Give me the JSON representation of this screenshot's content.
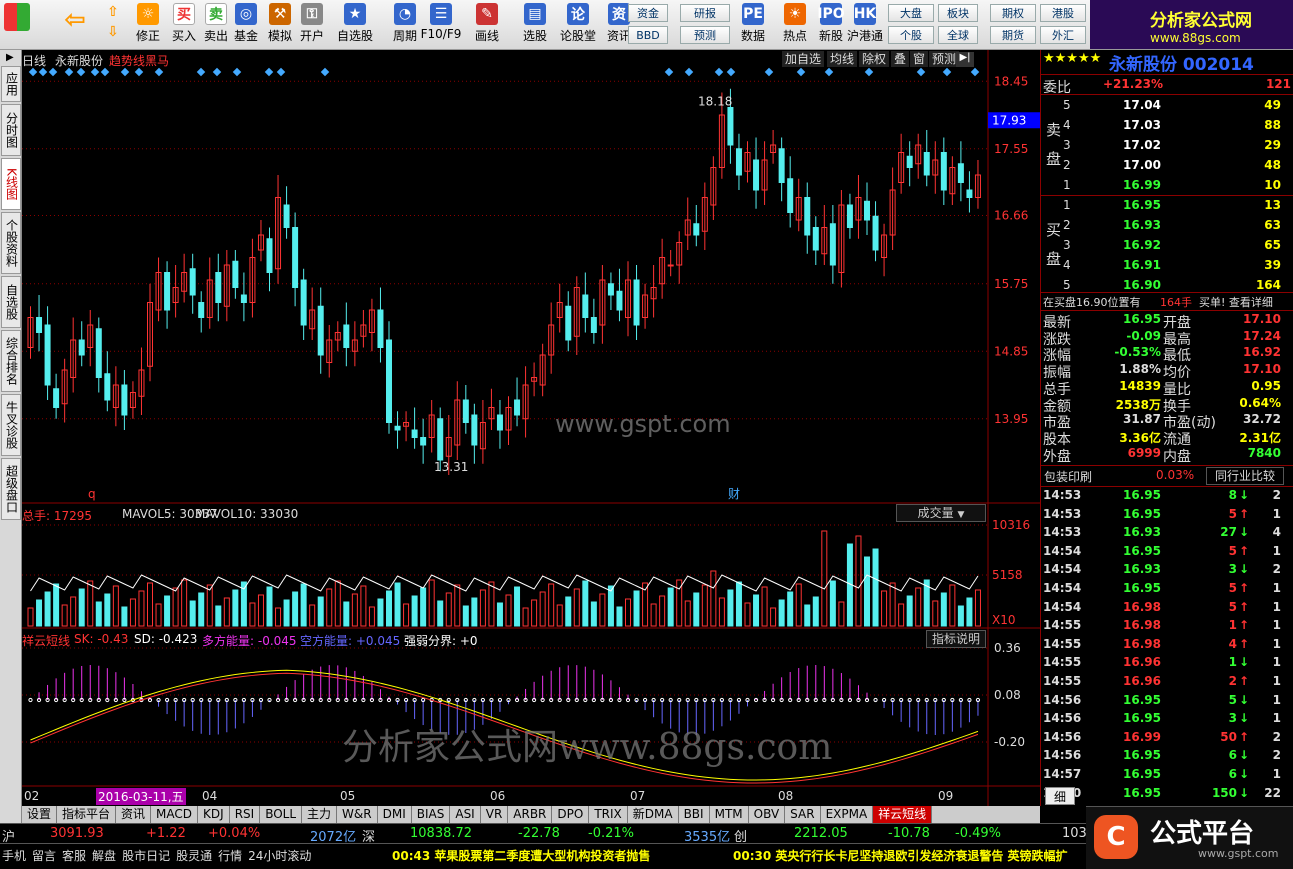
{
  "toolbar": {
    "buttons": [
      {
        "label": "修正",
        "icon": "gear-icon"
      },
      {
        "label": "买入",
        "icon": "buy-icon"
      },
      {
        "label": "卖出",
        "icon": "sell-icon"
      },
      {
        "label": "基金",
        "icon": "fund-icon"
      },
      {
        "label": "模拟",
        "icon": "hammer-icon"
      },
      {
        "label": "开户",
        "icon": "lock-icon"
      },
      {
        "label": "自选股",
        "icon": "star-icon"
      },
      {
        "label": "周期",
        "icon": "clock-icon"
      },
      {
        "label": "F10/F9",
        "icon": "doc-icon"
      },
      {
        "label": "画线",
        "icon": "pencil-icon"
      },
      {
        "label": "选股",
        "icon": "filter-icon"
      },
      {
        "label": "论股堂",
        "icon": "chat-icon"
      },
      {
        "label": "资讯",
        "icon": "news-icon"
      },
      {
        "label": "数据",
        "icon": "pe-icon"
      },
      {
        "label": "热点",
        "icon": "fire-icon"
      },
      {
        "label": "新股",
        "icon": "ipo-icon"
      },
      {
        "label": "沪港通",
        "icon": "hk-icon"
      }
    ],
    "small_buttons": [
      "资金",
      "BBD",
      "研报",
      "预测",
      "大盘",
      "个股",
      "板块",
      "全球",
      "期权",
      "期货",
      "港股",
      "外汇"
    ],
    "logo_title": "分析家公式网",
    "logo_url": "www.88gs.com"
  },
  "sidebar": [
    "应用",
    "分时图",
    "K线图",
    "个股资料",
    "自选股",
    "综合排名",
    "牛叉诊股",
    "超级盘口"
  ],
  "chart": {
    "period": "日线",
    "stock_name": "永新股份",
    "indicator": "趋势线黑马",
    "top_buttons": [
      "加自选",
      "均线",
      "除权",
      "叠",
      "窗",
      "预测"
    ],
    "price_ticks": [
      "18.45",
      "17.55",
      "16.66",
      "15.75",
      "14.85",
      "13.95"
    ],
    "current_price": "17.93",
    "high_label": "18.18",
    "low_label": "13.31",
    "watermark": "www.gspt.com",
    "marker_q": "q",
    "marker_cai": "财"
  },
  "volume": {
    "label": "总手: 17295",
    "mavol5": "MAVOL5: 30337",
    "mavol10": "MAVOL10: 33030",
    "selector": "成交量",
    "ticks": [
      "10316",
      "5158"
    ],
    "unit": "X10"
  },
  "indicator_panel": {
    "name": "祥云短线",
    "sk": "SK: -0.43",
    "sd": "SD: -0.423",
    "dfnl": "多方能量: -0.045",
    "kfnl": "空方能量: +0.045",
    "qrfj": "强弱分界: +0",
    "button": "指标说明",
    "ticks": [
      "0.36",
      "0.08",
      "-0.20"
    ],
    "watermark": "分析家公式网www.88gs.com"
  },
  "xaxis": {
    "labels": [
      "02",
      "04",
      "05",
      "06",
      "07",
      "08",
      "09"
    ],
    "cursor_date": "2016-03-11,五"
  },
  "bottom_tabs": [
    "设置",
    "指标平台",
    "资讯",
    "MACD",
    "KDJ",
    "RSI",
    "BOLL",
    "主力",
    "W&R",
    "DMI",
    "BIAS",
    "ASI",
    "VR",
    "ARBR",
    "DPO",
    "TRIX",
    "新DMA",
    "BBI",
    "MTM",
    "OBV",
    "SAR",
    "EXPMA",
    "祥云短线"
  ],
  "quote": {
    "title": "永新股份 002014",
    "weibi_label": "委比",
    "weibi": "+21.23%",
    "weicha": "121",
    "sell_label": "卖盘",
    "buy_label": "买盘",
    "sell": [
      {
        "n": "5",
        "p": "17.04",
        "v": "49"
      },
      {
        "n": "4",
        "p": "17.03",
        "v": "88"
      },
      {
        "n": "3",
        "p": "17.02",
        "v": "29"
      },
      {
        "n": "2",
        "p": "17.00",
        "v": "48"
      },
      {
        "n": "1",
        "p": "16.99",
        "v": "10"
      }
    ],
    "buy": [
      {
        "n": "1",
        "p": "16.95",
        "v": "13"
      },
      {
        "n": "2",
        "p": "16.93",
        "v": "63"
      },
      {
        "n": "3",
        "p": "16.92",
        "v": "65"
      },
      {
        "n": "4",
        "p": "16.91",
        "v": "39"
      },
      {
        "n": "5",
        "p": "16.90",
        "v": "164"
      }
    ],
    "order_note": "在买盘16.90位置有",
    "order_qty": "164手",
    "order_link": "买单! 查看详细",
    "stats": [
      [
        "最新",
        "16.95",
        "开盘",
        "17.10"
      ],
      [
        "涨跌",
        "-0.09",
        "最高",
        "17.24"
      ],
      [
        "涨幅",
        "-0.53%",
        "最低",
        "16.92"
      ],
      [
        "振幅",
        "1.88%",
        "均价",
        "17.10"
      ],
      [
        "总手",
        "14839",
        "量比",
        "0.95"
      ],
      [
        "金额",
        "2538万",
        "换手",
        "0.64%"
      ],
      [
        "市盈",
        "31.87",
        "市盈(动)",
        "32.72"
      ],
      [
        "股本",
        "3.36亿",
        "流通",
        "2.31亿"
      ],
      [
        "外盘",
        "6999",
        "内盘",
        "7840"
      ]
    ],
    "sector": "包装印刷",
    "sector_pct": "0.03%",
    "sector_btn": "同行业比较",
    "ticks": [
      [
        "14:53",
        "16.95",
        "8",
        "↓",
        "2"
      ],
      [
        "14:53",
        "16.95",
        "5",
        "↑",
        "1"
      ],
      [
        "14:53",
        "16.93",
        "27",
        "↓",
        "4"
      ],
      [
        "14:54",
        "16.95",
        "5",
        "↑",
        "1"
      ],
      [
        "14:54",
        "16.93",
        "3",
        "↓",
        "2"
      ],
      [
        "14:54",
        "16.95",
        "5",
        "↑",
        "1"
      ],
      [
        "14:54",
        "16.98",
        "5",
        "↑",
        "1"
      ],
      [
        "14:55",
        "16.98",
        "1",
        "↑",
        "1"
      ],
      [
        "14:55",
        "16.98",
        "4",
        "↑",
        "1"
      ],
      [
        "14:55",
        "16.96",
        "1",
        "↓",
        "1"
      ],
      [
        "14:55",
        "16.96",
        "2",
        "↑",
        "1"
      ],
      [
        "14:56",
        "16.95",
        "5",
        "↓",
        "1"
      ],
      [
        "14:56",
        "16.95",
        "3",
        "↓",
        "1"
      ],
      [
        "14:56",
        "16.99",
        "50",
        "↑",
        "2"
      ],
      [
        "14:56",
        "16.95",
        "6",
        "↓",
        "2"
      ],
      [
        "14:57",
        "16.95",
        "6",
        "↓",
        "1"
      ],
      [
        "15:00",
        "16.95",
        "150",
        "↓",
        "22"
      ]
    ],
    "tab_detail": "细"
  },
  "status": {
    "sh_label": "沪",
    "sh_idx": "3091.93",
    "sh_chg": "+1.22",
    "sh_pct": "+0.04%",
    "sh_amt": "2072亿",
    "sz_label": "深",
    "sz_idx": "10838.72",
    "sz_chg": "-22.78",
    "sz_pct": "-0.21%",
    "sz_amt": "3535亿",
    "cy_label": "创",
    "cy_idx": "2212.05",
    "cy_chg": "-10.78",
    "cy_pct": "-0.49%",
    "cy_num": "103"
  },
  "status2": {
    "items": [
      "手机",
      "留言",
      "客服",
      "解盘",
      "股市日记",
      "股灵通",
      "行情",
      "24小时滚动"
    ],
    "news1": "00:43 苹果股票第二季度遭大型机构投资者抛售",
    "news2": "00:30 英央行行长卡尼坚持退欧引发经济衰退警告 英镑跌幅扩",
    "brand": "公式平台",
    "brand_url": "www.gspt.com"
  }
}
